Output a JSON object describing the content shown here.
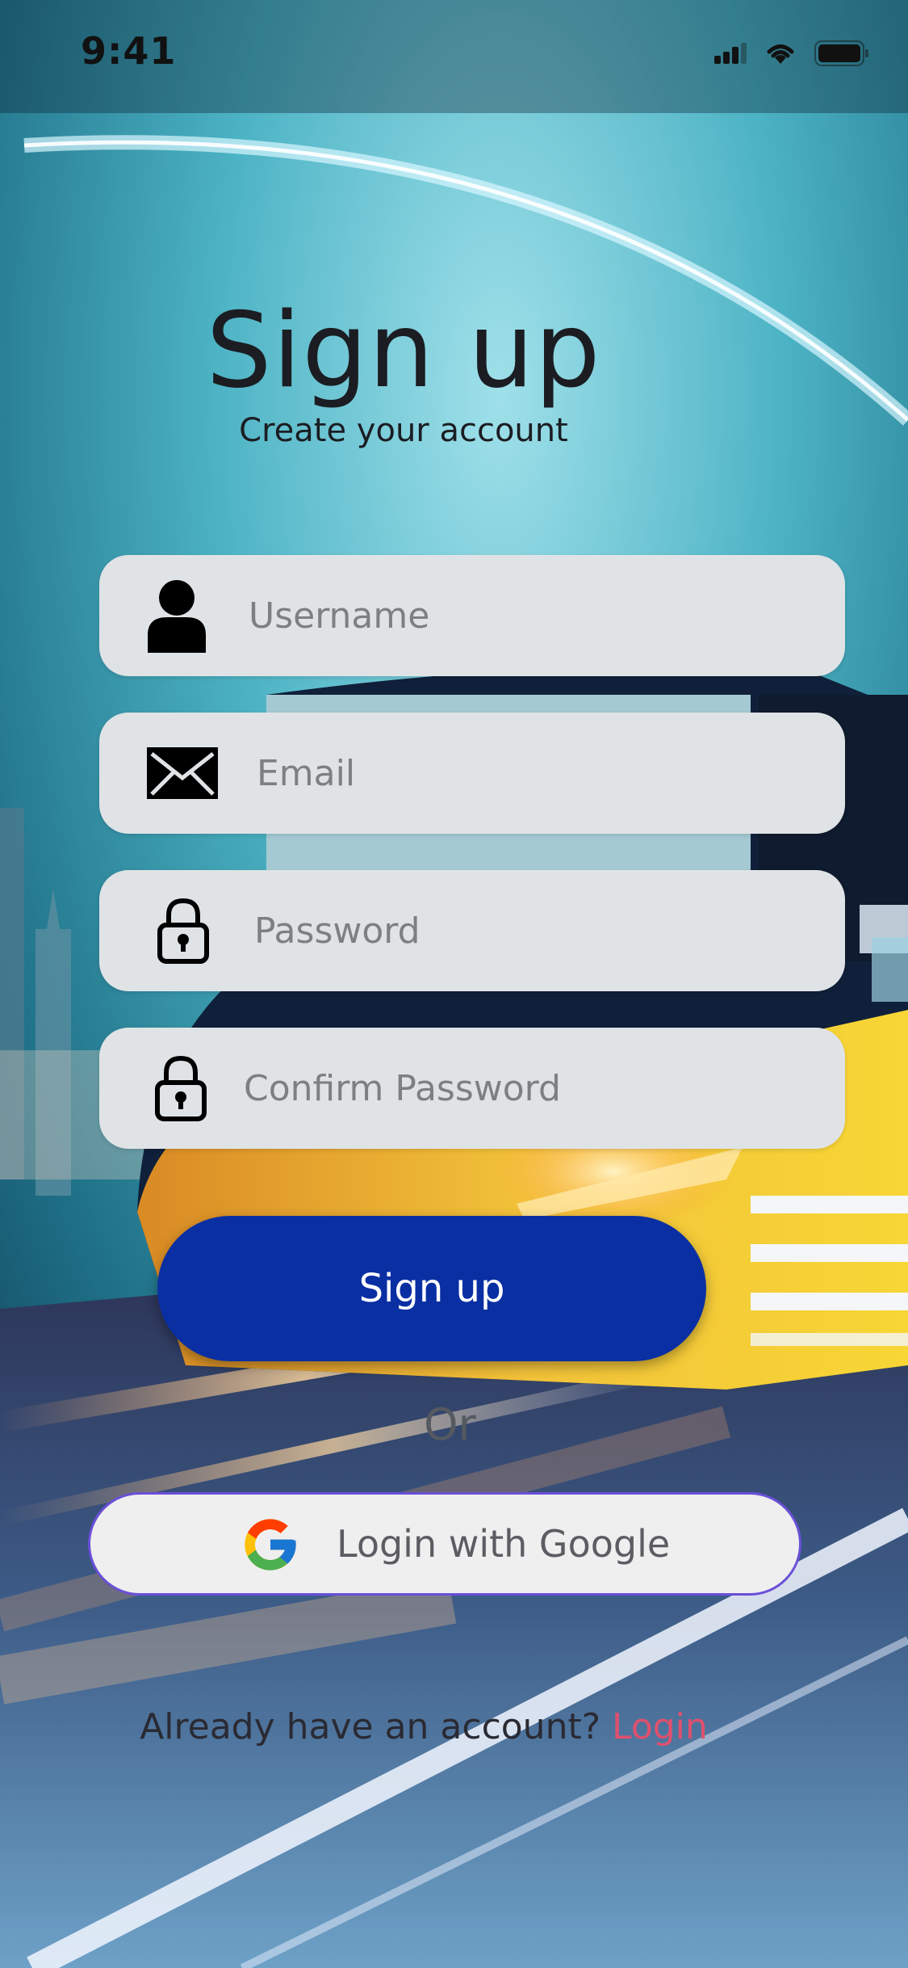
{
  "status_bar": {
    "time": "9:41"
  },
  "header": {
    "title": "Sign up",
    "subtitle": "Create your account"
  },
  "form": {
    "username_placeholder": "Username",
    "email_placeholder": "Email",
    "password_placeholder": "Password",
    "confirm_password_placeholder": "Confirm Password"
  },
  "actions": {
    "signup_label": "Sign up",
    "or_label": "Or",
    "google_label": "Login with Google"
  },
  "footer": {
    "prompt": "Already have an account?",
    "login_link": "Login"
  },
  "colors": {
    "primary_button": "#0a2fa3",
    "field_background": "#e0e3e6",
    "google_border": "#6a4fd8",
    "login_link": "#e0506e"
  },
  "icons": [
    "user-icon",
    "mail-icon",
    "lock-icon",
    "google-icon",
    "signal-icon",
    "wifi-icon",
    "battery-icon"
  ]
}
